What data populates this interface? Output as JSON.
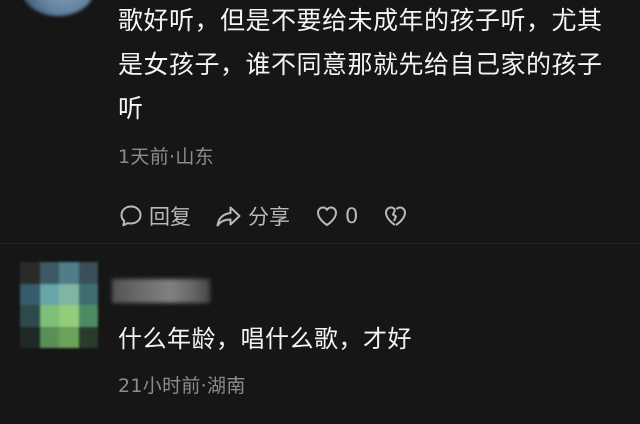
{
  "comments": [
    {
      "text_lines": [
        "歌好听，但是不要给未成年的孩子听，尤其",
        "是女孩子，谁不同意那就先给自己家的孩子",
        "听"
      ],
      "meta": "1天前·山东",
      "actions": {
        "reply_label": "回复",
        "share_label": "分享",
        "like_count": "0"
      }
    },
    {
      "username": "",
      "text": "什么年龄，唱什么歌，才好",
      "meta": "21小时前·湖南"
    }
  ],
  "colors": {
    "background": "#161616",
    "text": "#f4f4f4",
    "meta": "#8c8c8c",
    "action": "#b9b9b9"
  },
  "icons": [
    "comment-bubble-icon",
    "share-arrow-icon",
    "heart-icon",
    "broken-heart-icon"
  ]
}
